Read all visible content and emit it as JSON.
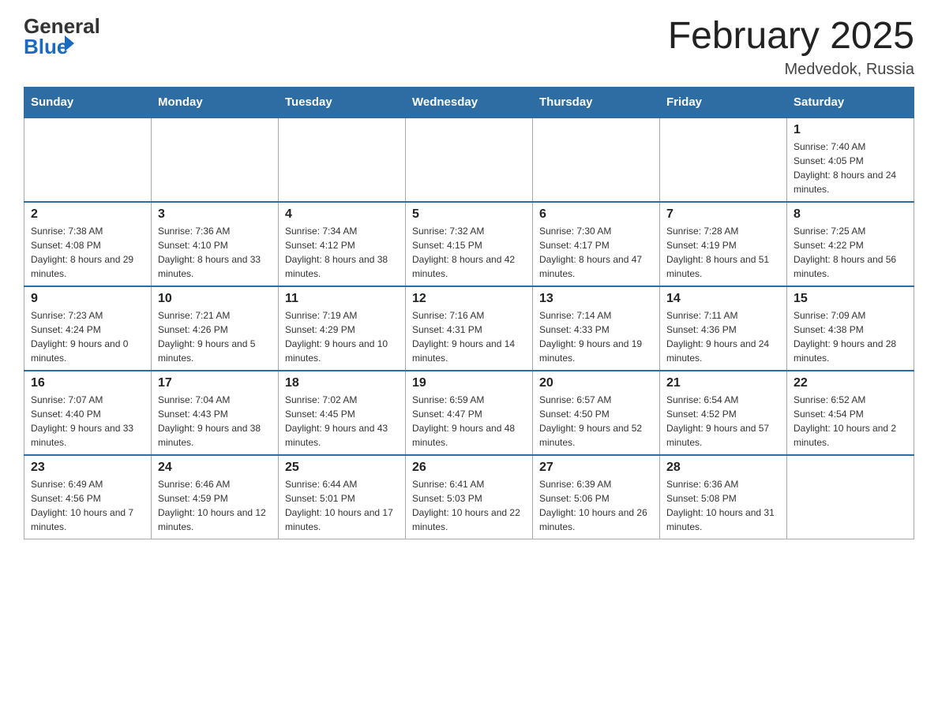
{
  "logo": {
    "general": "General",
    "blue": "Blue"
  },
  "title": "February 2025",
  "location": "Medvedok, Russia",
  "days_of_week": [
    "Sunday",
    "Monday",
    "Tuesday",
    "Wednesday",
    "Thursday",
    "Friday",
    "Saturday"
  ],
  "weeks": [
    [
      {
        "day": "",
        "info": ""
      },
      {
        "day": "",
        "info": ""
      },
      {
        "day": "",
        "info": ""
      },
      {
        "day": "",
        "info": ""
      },
      {
        "day": "",
        "info": ""
      },
      {
        "day": "",
        "info": ""
      },
      {
        "day": "1",
        "info": "Sunrise: 7:40 AM\nSunset: 4:05 PM\nDaylight: 8 hours and 24 minutes."
      }
    ],
    [
      {
        "day": "2",
        "info": "Sunrise: 7:38 AM\nSunset: 4:08 PM\nDaylight: 8 hours and 29 minutes."
      },
      {
        "day": "3",
        "info": "Sunrise: 7:36 AM\nSunset: 4:10 PM\nDaylight: 8 hours and 33 minutes."
      },
      {
        "day": "4",
        "info": "Sunrise: 7:34 AM\nSunset: 4:12 PM\nDaylight: 8 hours and 38 minutes."
      },
      {
        "day": "5",
        "info": "Sunrise: 7:32 AM\nSunset: 4:15 PM\nDaylight: 8 hours and 42 minutes."
      },
      {
        "day": "6",
        "info": "Sunrise: 7:30 AM\nSunset: 4:17 PM\nDaylight: 8 hours and 47 minutes."
      },
      {
        "day": "7",
        "info": "Sunrise: 7:28 AM\nSunset: 4:19 PM\nDaylight: 8 hours and 51 minutes."
      },
      {
        "day": "8",
        "info": "Sunrise: 7:25 AM\nSunset: 4:22 PM\nDaylight: 8 hours and 56 minutes."
      }
    ],
    [
      {
        "day": "9",
        "info": "Sunrise: 7:23 AM\nSunset: 4:24 PM\nDaylight: 9 hours and 0 minutes."
      },
      {
        "day": "10",
        "info": "Sunrise: 7:21 AM\nSunset: 4:26 PM\nDaylight: 9 hours and 5 minutes."
      },
      {
        "day": "11",
        "info": "Sunrise: 7:19 AM\nSunset: 4:29 PM\nDaylight: 9 hours and 10 minutes."
      },
      {
        "day": "12",
        "info": "Sunrise: 7:16 AM\nSunset: 4:31 PM\nDaylight: 9 hours and 14 minutes."
      },
      {
        "day": "13",
        "info": "Sunrise: 7:14 AM\nSunset: 4:33 PM\nDaylight: 9 hours and 19 minutes."
      },
      {
        "day": "14",
        "info": "Sunrise: 7:11 AM\nSunset: 4:36 PM\nDaylight: 9 hours and 24 minutes."
      },
      {
        "day": "15",
        "info": "Sunrise: 7:09 AM\nSunset: 4:38 PM\nDaylight: 9 hours and 28 minutes."
      }
    ],
    [
      {
        "day": "16",
        "info": "Sunrise: 7:07 AM\nSunset: 4:40 PM\nDaylight: 9 hours and 33 minutes."
      },
      {
        "day": "17",
        "info": "Sunrise: 7:04 AM\nSunset: 4:43 PM\nDaylight: 9 hours and 38 minutes."
      },
      {
        "day": "18",
        "info": "Sunrise: 7:02 AM\nSunset: 4:45 PM\nDaylight: 9 hours and 43 minutes."
      },
      {
        "day": "19",
        "info": "Sunrise: 6:59 AM\nSunset: 4:47 PM\nDaylight: 9 hours and 48 minutes."
      },
      {
        "day": "20",
        "info": "Sunrise: 6:57 AM\nSunset: 4:50 PM\nDaylight: 9 hours and 52 minutes."
      },
      {
        "day": "21",
        "info": "Sunrise: 6:54 AM\nSunset: 4:52 PM\nDaylight: 9 hours and 57 minutes."
      },
      {
        "day": "22",
        "info": "Sunrise: 6:52 AM\nSunset: 4:54 PM\nDaylight: 10 hours and 2 minutes."
      }
    ],
    [
      {
        "day": "23",
        "info": "Sunrise: 6:49 AM\nSunset: 4:56 PM\nDaylight: 10 hours and 7 minutes."
      },
      {
        "day": "24",
        "info": "Sunrise: 6:46 AM\nSunset: 4:59 PM\nDaylight: 10 hours and 12 minutes."
      },
      {
        "day": "25",
        "info": "Sunrise: 6:44 AM\nSunset: 5:01 PM\nDaylight: 10 hours and 17 minutes."
      },
      {
        "day": "26",
        "info": "Sunrise: 6:41 AM\nSunset: 5:03 PM\nDaylight: 10 hours and 22 minutes."
      },
      {
        "day": "27",
        "info": "Sunrise: 6:39 AM\nSunset: 5:06 PM\nDaylight: 10 hours and 26 minutes."
      },
      {
        "day": "28",
        "info": "Sunrise: 6:36 AM\nSunset: 5:08 PM\nDaylight: 10 hours and 31 minutes."
      },
      {
        "day": "",
        "info": ""
      }
    ]
  ]
}
